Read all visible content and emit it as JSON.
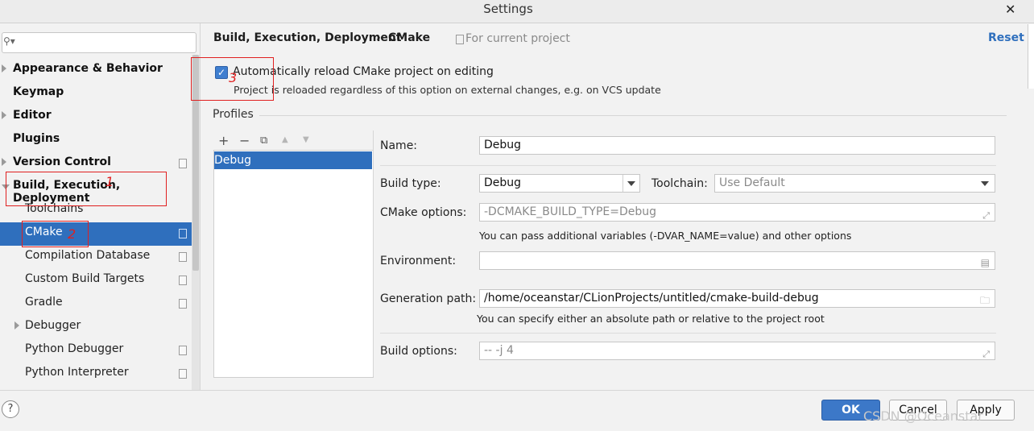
{
  "window": {
    "title": "Settings",
    "close_glyph": "✕"
  },
  "sidebar": {
    "search_placeholder": "",
    "items": [
      {
        "label": "Appearance & Behavior",
        "level": "top",
        "expandable": true,
        "expanded": false,
        "project_scope": false
      },
      {
        "label": "Keymap",
        "level": "top",
        "expandable": false,
        "project_scope": false
      },
      {
        "label": "Editor",
        "level": "top",
        "expandable": true,
        "expanded": false,
        "project_scope": false
      },
      {
        "label": "Plugins",
        "level": "top",
        "expandable": false,
        "project_scope": false
      },
      {
        "label": "Version Control",
        "level": "top",
        "expandable": true,
        "expanded": false,
        "project_scope": true
      },
      {
        "label": "Build, Execution, Deployment",
        "level": "top",
        "expandable": true,
        "expanded": true,
        "project_scope": false
      },
      {
        "label": "Toolchains",
        "level": "sub",
        "project_scope": false
      },
      {
        "label": "CMake",
        "level": "sub",
        "selected": true,
        "project_scope": true
      },
      {
        "label": "Compilation Database",
        "level": "sub",
        "project_scope": true
      },
      {
        "label": "Custom Build Targets",
        "level": "sub",
        "project_scope": true
      },
      {
        "label": "Gradle",
        "level": "sub",
        "project_scope": true
      },
      {
        "label": "Debugger",
        "level": "sub",
        "expandable": true,
        "project_scope": false
      },
      {
        "label": "Python Debugger",
        "level": "sub",
        "project_scope": true
      },
      {
        "label": "Python Interpreter",
        "level": "sub",
        "project_scope": true
      }
    ]
  },
  "header": {
    "breadcrumb_parent": "Build, Execution, Deployment",
    "breadcrumb_sep": "›",
    "breadcrumb_current": "CMake",
    "scope_text": "For current project",
    "reset_label": "Reset"
  },
  "auto_reload": {
    "checked": true,
    "label": "Automatically reload CMake project on editing",
    "hint": "Project is reloaded regardless of this option on external changes, e.g. on VCS update"
  },
  "profiles": {
    "title": "Profiles",
    "toolbar": [
      "+",
      "−",
      "⧉",
      "▲",
      "▼"
    ],
    "list": [
      "Debug"
    ],
    "selected": "Debug"
  },
  "form": {
    "name_label": "Name:",
    "name_value": "Debug",
    "build_type_label": "Build type:",
    "build_type_value": "Debug",
    "toolchain_label": "Toolchain:",
    "toolchain_value": "Use Default",
    "cmake_options_label": "CMake options:",
    "cmake_options_value": "-DCMAKE_BUILD_TYPE=Debug",
    "cmake_options_hint": "You can pass additional variables (-DVAR_NAME=value) and other options",
    "environment_label": "Environment:",
    "environment_value": "",
    "generation_path_label": "Generation path:",
    "generation_path_value": "/home/oceanstar/CLionProjects/untitled/cmake-build-debug",
    "generation_path_hint": "You can specify either an absolute path or relative to the project root",
    "build_options_label": "Build options:",
    "build_options_value": "-- -j 4"
  },
  "footer": {
    "help_label": "?",
    "ok_label": "OK",
    "cancel_label": "Cancel",
    "apply_label": "Apply"
  },
  "annotations": [
    "1",
    "2",
    "3"
  ],
  "watermark": "CSDN @Oceanstar",
  "colors": {
    "selection": "#2f6fbd",
    "annotation": "#e02020",
    "link": "#2f6fbd"
  }
}
